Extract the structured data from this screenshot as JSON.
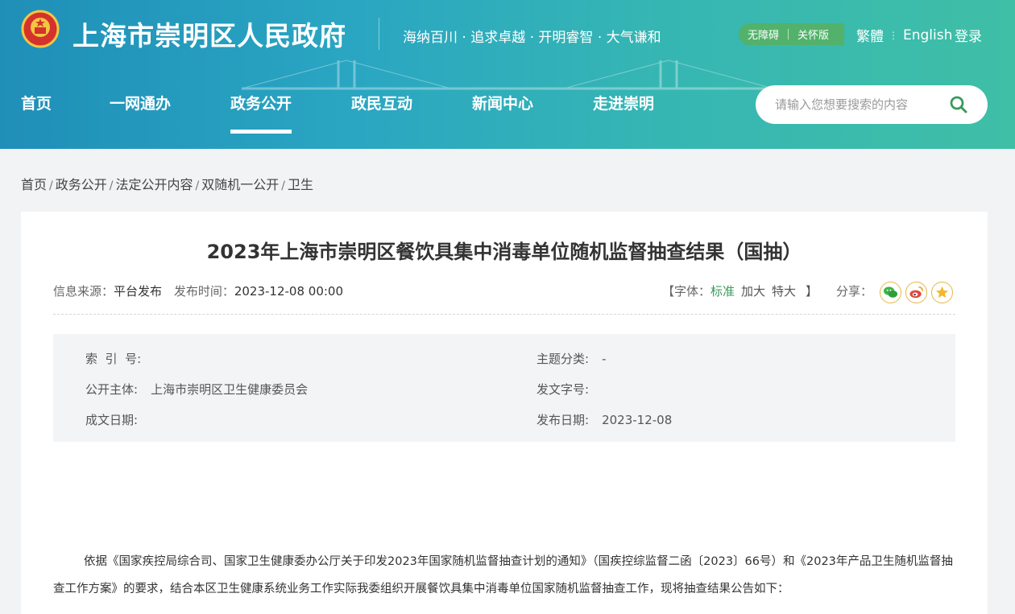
{
  "header": {
    "site_title": "上海市崇明区人民政府",
    "slogan": "海纳百川 · 追求卓越 · 开明睿智 · 大气谦和",
    "accessibility": "无障碍",
    "care_mode": "关怀版",
    "traditional": "繁體",
    "english": "English",
    "login": "登录"
  },
  "nav": {
    "items": [
      {
        "label": "首页"
      },
      {
        "label": "一网通办"
      },
      {
        "label": "政务公开"
      },
      {
        "label": "政民互动"
      },
      {
        "label": "新闻中心"
      },
      {
        "label": "走进崇明"
      }
    ],
    "active_index": 2
  },
  "search": {
    "placeholder": "请输入您想要搜索的内容"
  },
  "breadcrumb": [
    "首页",
    "政务公开",
    "法定公开内容",
    "双随机一公开",
    "卫生"
  ],
  "article": {
    "title": "2023年上海市崇明区餐饮具集中消毒单位随机监督抽查结果（国抽）",
    "source_label": "信息来源：",
    "source_value": "平台发布",
    "time_label": "发布时间：",
    "time_value": "2023-12-08 00:00",
    "font_label_open": "【字体：",
    "font_standard": "标准",
    "font_large": "加大",
    "font_xlarge": "特大",
    "font_label_close": "】",
    "share_label": "分享："
  },
  "info": {
    "index_label": "索  引  号:",
    "index_value": "",
    "topic_label": "主题分类:",
    "topic_value": "-",
    "publisher_label": "公开主体:",
    "publisher_value": "上海市崇明区卫生健康委员会",
    "doc_no_label": "发文字号:",
    "doc_no_value": "",
    "created_label": "成文日期:",
    "created_value": "",
    "pub_date_label": "发布日期:",
    "pub_date_value": "2023-12-08"
  },
  "body": {
    "paragraph": "依据《国家疾控局综合司、国家卫生健康委办公厅关于印发2023年国家随机监督抽查计划的通知》（国疾控综监督二函〔2023〕66号）和《2023年产品卫生随机监督抽查工作方案》的要求，结合本区卫生健康系统业务工作实际我委组织开展餐饮具集中消毒单位国家随机监督抽查工作，现将抽查结果公告如下："
  },
  "colors": {
    "header_start": "#1f8fb8",
    "header_end": "#3fbfa6",
    "accent_green": "#3a9a5c",
    "a11y_bg": "#52b26b"
  },
  "icons": [
    "emblem-icon",
    "search-icon",
    "wechat-icon",
    "weibo-icon",
    "favorite-icon"
  ]
}
